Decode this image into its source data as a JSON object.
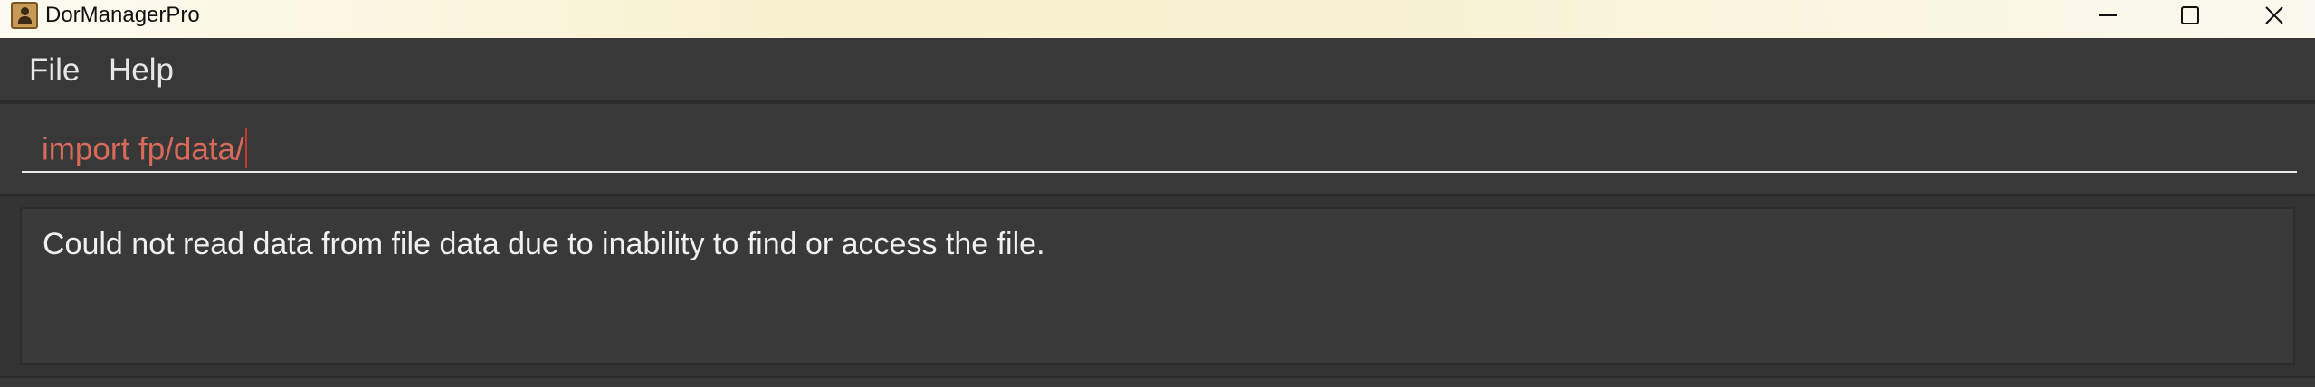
{
  "window": {
    "title": "DorManagerPro",
    "icon": "contacts-book-icon",
    "controls": [
      "minimize-icon",
      "maximize-icon",
      "close-icon"
    ]
  },
  "menu": {
    "items": [
      {
        "label": "File"
      },
      {
        "label": "Help"
      }
    ]
  },
  "command_box": {
    "value": "import fp/data/",
    "text_color": "#d86a5a"
  },
  "result_display": {
    "message": "Could not read data from file data due to inability to find or access the file."
  },
  "colors": {
    "background": "#333333",
    "panel": "#383838",
    "titlebar": "#f8f1cf",
    "error_text": "#d86a5a"
  }
}
